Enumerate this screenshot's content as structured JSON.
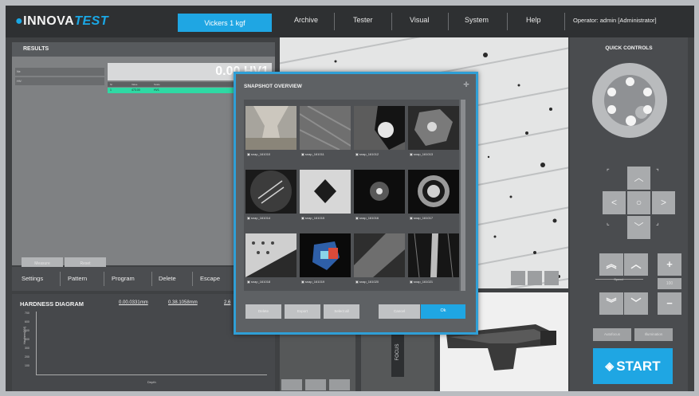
{
  "header": {
    "logo_prefix": "INNOVA",
    "logo_suffix": "TEST",
    "mode": "Vickers 1 kgf",
    "nav": [
      "Archive",
      "Tester",
      "Visual",
      "System",
      "Help"
    ],
    "operator": "Operator: admin   [Administrator]"
  },
  "results": {
    "title": "RESULTS",
    "hv_value": "0.00 HV1",
    "row_labels": [
      "Nr:",
      "HV:"
    ],
    "table_headers": [
      "Nr",
      "Value",
      "Scale"
    ],
    "table_row": [
      "1",
      "473.00",
      "HV1"
    ],
    "buttons": [
      "Measure",
      "Reset"
    ]
  },
  "actions": [
    "Settings",
    "Pattern",
    "Program",
    "Delete",
    "Escape"
  ],
  "diagram": {
    "title": "HARDNESS DIAGRAM",
    "values": [
      "0.00.0331mm",
      "0.38.1058mm",
      "2.6"
    ],
    "y_ticks": [
      "700",
      "600",
      "500",
      "400",
      "300",
      "200",
      "100"
    ],
    "ylabel": "Hardness[HV]",
    "xlabel": "Depth"
  },
  "side_label": "FOCUS",
  "quick_controls": {
    "title": "QUICK CONTROLS",
    "speed_label": "Speed",
    "small_buttons": [
      "Autofocus",
      "Illumination"
    ],
    "start_label": "START",
    "plus": "+",
    "minus": "−",
    "mid": "100"
  },
  "modal": {
    "title": "SNAPSHOT OVERVIEW",
    "thumbnails": [
      {
        "caption": "snap_161010"
      },
      {
        "caption": "snap_161011"
      },
      {
        "caption": "snap_161012"
      },
      {
        "caption": "snap_161013"
      },
      {
        "caption": "snap_161014"
      },
      {
        "caption": "snap_161015"
      },
      {
        "caption": "snap_161016"
      },
      {
        "caption": "snap_161017"
      },
      {
        "caption": "snap_161018"
      },
      {
        "caption": "snap_161019"
      },
      {
        "caption": "snap_161020"
      },
      {
        "caption": "snap_161021"
      }
    ],
    "buttons": [
      "Delete",
      "Export",
      "Select all"
    ],
    "cancel_label": "Cancel",
    "ok_label": "Ok"
  },
  "colors": {
    "accent": "#1fa6e3",
    "table_highlight": "#2fd9a4"
  }
}
